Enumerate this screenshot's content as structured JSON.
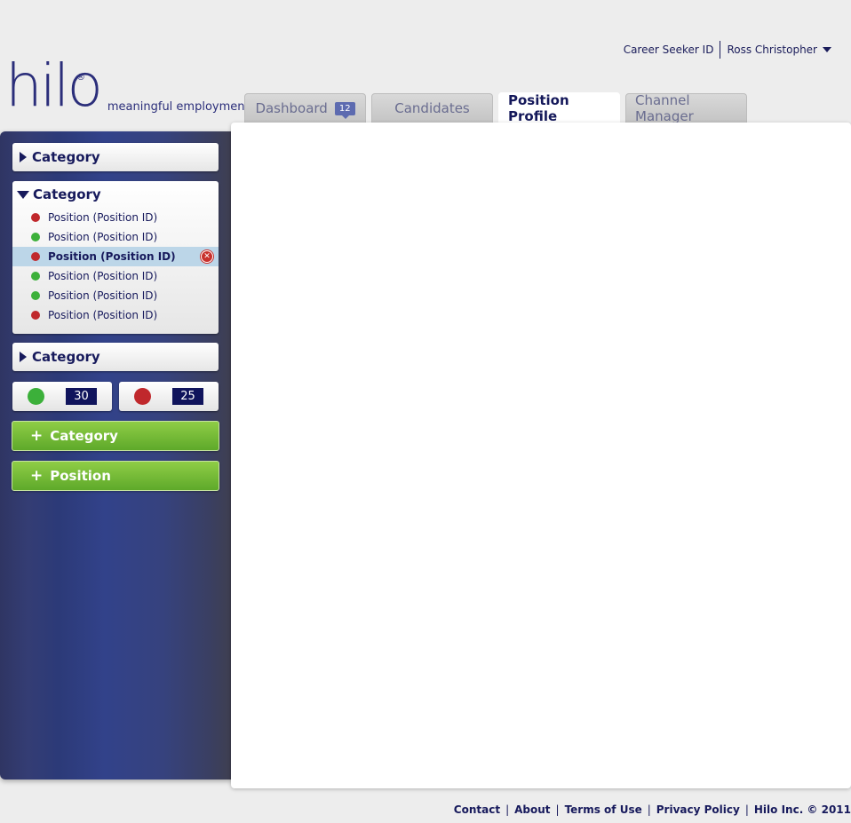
{
  "user": {
    "seeker_id_label": "Career Seeker ID",
    "name": "Ross Christopher"
  },
  "brand": {
    "logo": "hilo",
    "registered": "®",
    "tagline": "meaningful employment."
  },
  "tabs": [
    {
      "label": "Dashboard",
      "count": "12"
    },
    {
      "label": "Candidates"
    },
    {
      "label": "Position Profile"
    },
    {
      "label": "Channel Manager"
    }
  ],
  "sidebar": {
    "category_top": "Category",
    "category_open": "Category",
    "positions": [
      {
        "label": "Position (Position ID)",
        "status": "red"
      },
      {
        "label": "Position (Position ID)",
        "status": "green"
      },
      {
        "label": "Position (Position ID)",
        "status": "red"
      },
      {
        "label": "Position (Position ID)",
        "status": "green"
      },
      {
        "label": "Position (Position ID)",
        "status": "green"
      },
      {
        "label": "Position (Position ID)",
        "status": "red"
      }
    ],
    "category_bottom": "Category",
    "stats": {
      "green_count": "30",
      "red_count": "25"
    },
    "add_category_label": "Category",
    "add_position_label": "Position",
    "plus_symbol": "+"
  },
  "footer": {
    "links": [
      "Contact",
      "About",
      "Terms of Use",
      "Privacy Policy"
    ],
    "copyright": "Hilo Inc. © 2011",
    "separator": "|"
  },
  "colors": {
    "accent": "#171a5c",
    "status_red": "#c0282c",
    "status_green": "#3cb03a",
    "button_green": "#6cb52f"
  }
}
